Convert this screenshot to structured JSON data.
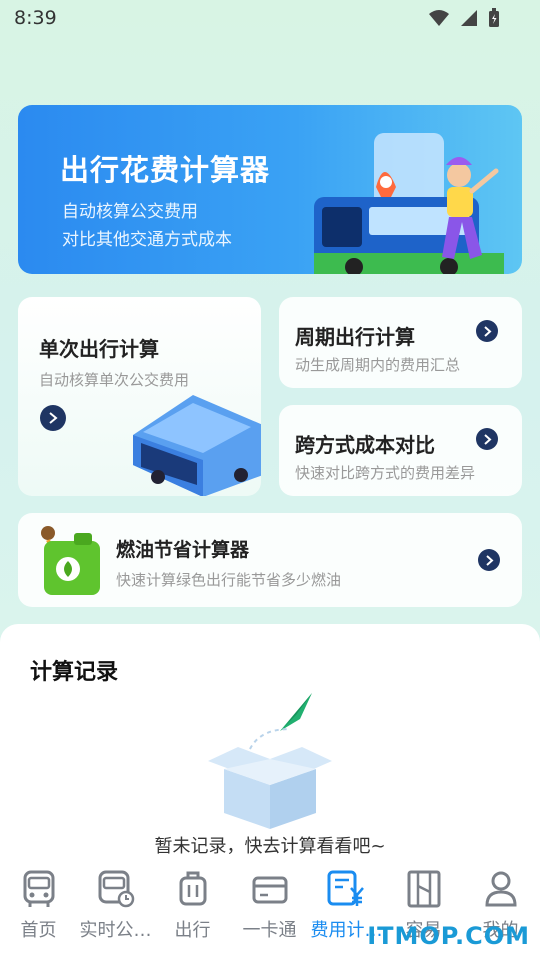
{
  "status": {
    "time": "8:39"
  },
  "hero": {
    "title": "出行花费计算器",
    "line1": "自动核算公交费用",
    "line2": "对比其他交通方式成本"
  },
  "cards": {
    "single": {
      "title": "单次出行计算",
      "sub": "自动核算单次公交费用"
    },
    "period": {
      "title": "周期出行计算",
      "sub": "动生成周期内的费用汇总"
    },
    "cross": {
      "title": "跨方式成本对比",
      "sub": "快速对比跨方式的费用差异"
    },
    "fuel": {
      "title": "燃油节省计算器",
      "sub": "快速计算绿色出行能节省多少燃油"
    }
  },
  "records": {
    "title": "计算记录",
    "empty_text": "暂未记录，快去计算看看吧~"
  },
  "tabs": [
    {
      "label": "首页",
      "icon": "bus-front-icon"
    },
    {
      "label": "实时公…",
      "icon": "bus-clock-icon"
    },
    {
      "label": "出行",
      "icon": "luggage-icon"
    },
    {
      "label": "一卡通",
      "icon": "card-icon"
    },
    {
      "label": "费用计…",
      "icon": "fee-calculator-icon",
      "active": true
    },
    {
      "label": "容易",
      "icon": "book-icon"
    },
    {
      "label": "我的",
      "icon": "person-icon"
    }
  ],
  "watermark": "ITMOP.COM",
  "colors": {
    "accent": "#1a8cf0",
    "arrow": "#1f3563",
    "hero_start": "#2b8af0",
    "hero_end": "#5ec6f3"
  }
}
